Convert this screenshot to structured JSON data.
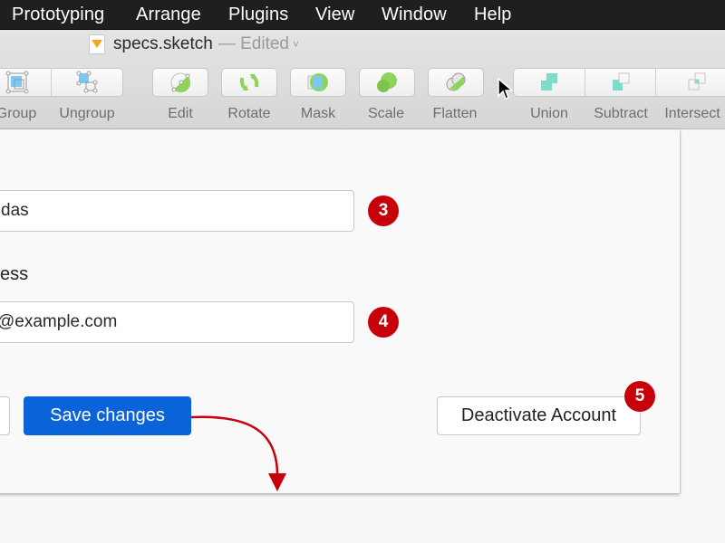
{
  "menubar": {
    "items": [
      {
        "label": "Prototyping"
      },
      {
        "label": "Arrange"
      },
      {
        "label": "Plugins"
      },
      {
        "label": "View"
      },
      {
        "label": "Window"
      },
      {
        "label": "Help"
      }
    ]
  },
  "window": {
    "doc_icon": "sketch-file-icon",
    "doc_name": "specs.sketch",
    "doc_status": "— Edited",
    "chevron": "˅"
  },
  "toolbar": {
    "items": [
      {
        "label": "Group",
        "icon": "group-icon"
      },
      {
        "label": "Ungroup",
        "icon": "ungroup-icon"
      },
      {
        "label": "Edit",
        "icon": "edit-icon"
      },
      {
        "label": "Rotate",
        "icon": "rotate-icon"
      },
      {
        "label": "Mask",
        "icon": "mask-icon"
      },
      {
        "label": "Scale",
        "icon": "scale-icon"
      },
      {
        "label": "Flatten",
        "icon": "flatten-icon"
      },
      {
        "label": "Union",
        "icon": "union-icon"
      },
      {
        "label": "Subtract",
        "icon": "subtract-icon"
      },
      {
        "label": "Intersect",
        "icon": "intersect-icon"
      }
    ]
  },
  "form": {
    "name_field": {
      "value": "das",
      "badge": "3"
    },
    "email_label": "ess",
    "email_field": {
      "value": "@example.com",
      "badge": "4"
    },
    "save_button": "Save changes",
    "deactivate_button": "Deactivate Account",
    "deactivate_badge": "5"
  },
  "annotation": {
    "arrow_color": "#c8000a",
    "badge_color": "#c8000a"
  },
  "colors": {
    "primary": "#0a63d8",
    "menubar_bg": "#1f1f1f",
    "green_icon": "#8cd45a",
    "teal_icon": "#7fdcc9",
    "blue_icon": "#7cc8f2"
  }
}
